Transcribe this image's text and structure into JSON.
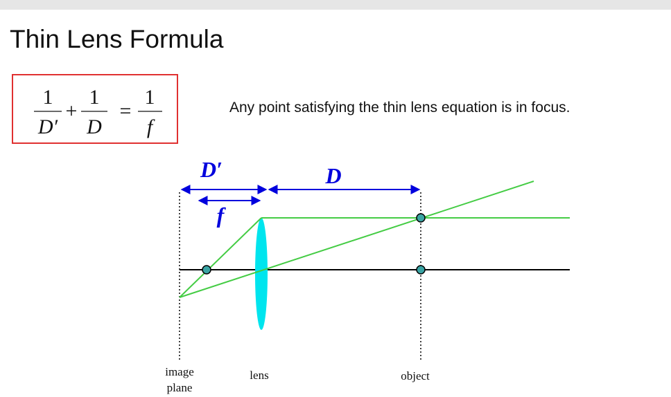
{
  "slide": {
    "title": "Thin Lens Formula",
    "statement": "Any point satisfying the thin lens equation is in focus."
  },
  "formula": {
    "term1": {
      "numerator": "1",
      "denominator": "D′"
    },
    "plus": "+",
    "term2": {
      "numerator": "1",
      "denominator": "D"
    },
    "equals": "=",
    "term3": {
      "numerator": "1",
      "denominator": "f"
    }
  },
  "diagram": {
    "labels": {
      "d_prime": "D′",
      "d": "D",
      "f": "f",
      "image_plane_line1": "image",
      "image_plane_line2": "plane",
      "lens": "lens",
      "object": "object"
    },
    "colors": {
      "ray": "#44cc44",
      "lens": "#00e5ee",
      "dimension_arrow": "#0000dd",
      "axis": "#000000",
      "box_border": "#e03030",
      "focal_point_fill": "#3aa4a4"
    }
  }
}
